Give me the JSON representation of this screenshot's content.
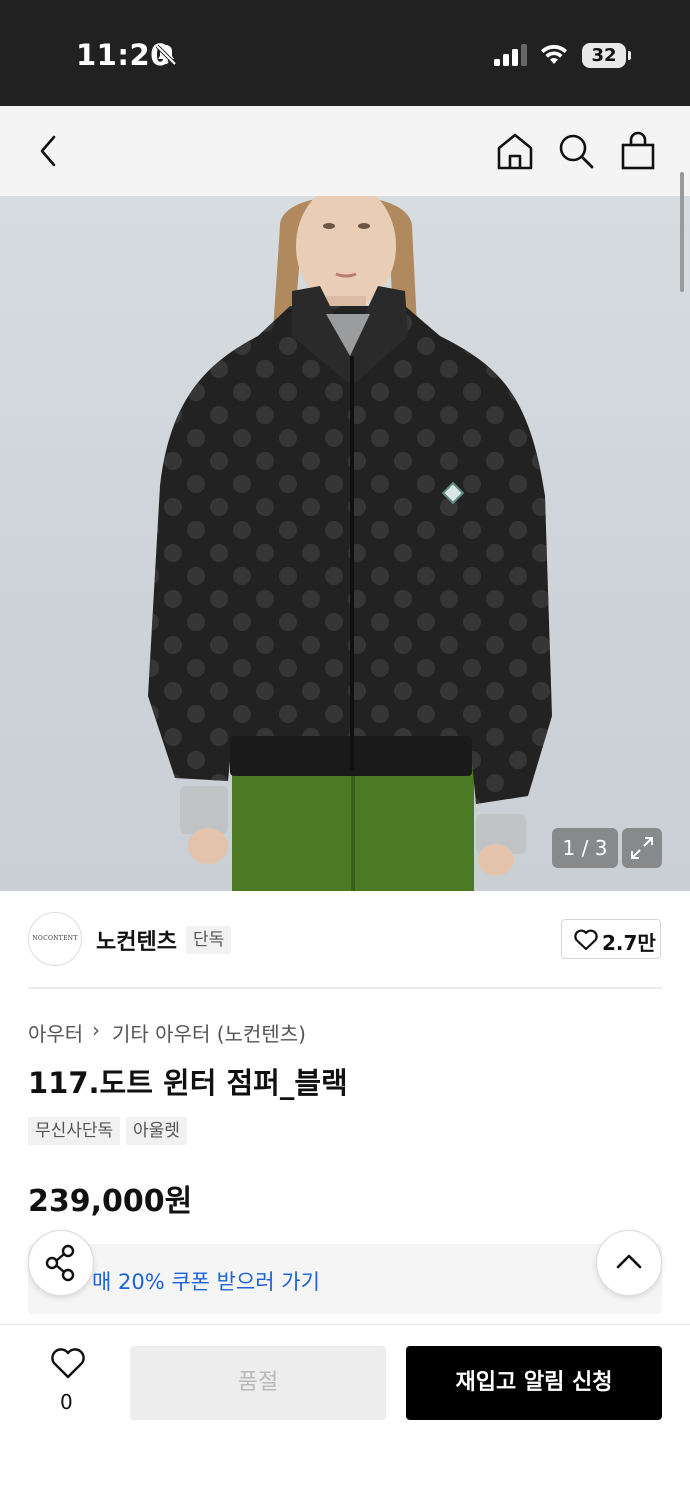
{
  "status_bar": {
    "time": "11:20",
    "battery": "32"
  },
  "product": {
    "image_counter": "1 / 3",
    "brand": {
      "name": "노컨텐츠",
      "exclusive_tag": "단독",
      "logo_text": "NOCONTENT"
    },
    "likes": "2.7만",
    "breadcrumb": {
      "category": "아우터",
      "separator": "›",
      "subcategory": "기타 아우터 (노컨텐츠)"
    },
    "title": "117.도트 윈터 점퍼_블랙",
    "tags": [
      "무신사단독",
      "아울렛"
    ],
    "price": "239,000원",
    "coupon_text": "매 20% 쿠폰 받으러 가기"
  },
  "bottom_bar": {
    "like_count": "0",
    "soldout_label": "품절",
    "restock_label": "재입고 알림 신청"
  },
  "colors": {
    "accent_blue": "#1c63d8",
    "status_bar_bg": "#212121",
    "button_black": "#000000"
  },
  "icons": [
    "back-icon",
    "home-icon",
    "search-icon",
    "bag-icon",
    "expand-icon",
    "heart-icon",
    "share-icon",
    "chevron-up-icon",
    "bell-muted-icon",
    "signal-icon",
    "wifi-icon"
  ]
}
